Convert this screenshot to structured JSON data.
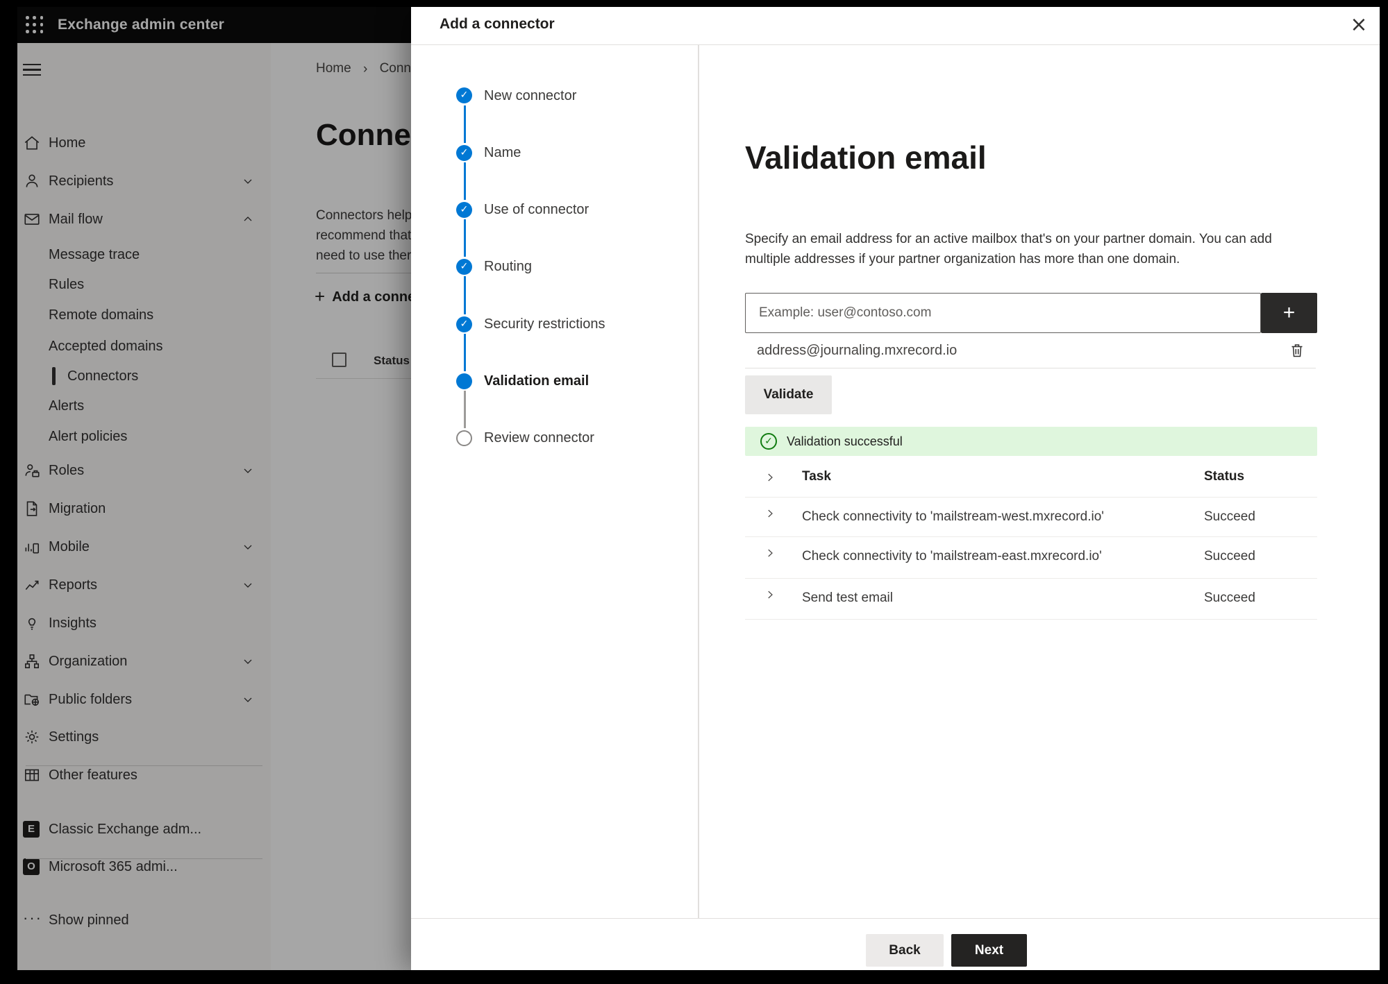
{
  "app_bar": {
    "title": "Exchange admin center"
  },
  "sidebar": {
    "items": [
      {
        "label": "Home"
      },
      {
        "label": "Recipients"
      },
      {
        "label": "Mail flow"
      },
      {
        "label": "Message trace"
      },
      {
        "label": "Rules"
      },
      {
        "label": "Remote domains"
      },
      {
        "label": "Accepted domains"
      },
      {
        "label": "Connectors",
        "selected": true
      },
      {
        "label": "Alerts"
      },
      {
        "label": "Alert policies"
      },
      {
        "label": "Roles"
      },
      {
        "label": "Migration"
      },
      {
        "label": "Mobile"
      },
      {
        "label": "Reports"
      },
      {
        "label": "Insights"
      },
      {
        "label": "Organization"
      },
      {
        "label": "Public folders"
      },
      {
        "label": "Settings"
      },
      {
        "label": "Other features"
      },
      {
        "label": "Classic Exchange adm..."
      },
      {
        "label": "Microsoft 365 admi..."
      },
      {
        "label": "Show pinned"
      }
    ]
  },
  "background_page": {
    "breadcrumb": {
      "home": "Home",
      "current": "Connectors"
    },
    "heading": "Connectors",
    "paragraph_lines": [
      "Connectors help",
      "recommend that",
      "need to use ther"
    ],
    "add_button": "Add a connector",
    "column_header": "Status"
  },
  "modal": {
    "title": "Add a connector",
    "close_label": "×",
    "steps": [
      {
        "label": "New connector",
        "state": "done"
      },
      {
        "label": "Name",
        "state": "done"
      },
      {
        "label": "Use of connector",
        "state": "done"
      },
      {
        "label": "Routing",
        "state": "done"
      },
      {
        "label": "Security restrictions",
        "state": "done"
      },
      {
        "label": "Validation email",
        "state": "current"
      },
      {
        "label": "Review connector",
        "state": "upcoming"
      }
    ],
    "content": {
      "title": "Validation email",
      "description": "Specify an email address for an active mailbox that's on your partner domain. You can add multiple addresses if your partner organization has more than one domain.",
      "input_placeholder": "Example: user@contoso.com",
      "add_address_label": "+",
      "added_address": "address@journaling.mxrecord.io",
      "validate_button": "Validate",
      "banner_text": "Validation successful",
      "banner_check": "✓",
      "table": {
        "task_header": "Task",
        "status_header": "Status",
        "rows": [
          {
            "task": "Check connectivity to 'mailstream-west.mxrecord.io'",
            "status": "Succeed"
          },
          {
            "task": "Check connectivity to 'mailstream-east.mxrecord.io'",
            "status": "Succeed"
          },
          {
            "task": "Send test email",
            "status": "Succeed"
          }
        ]
      }
    },
    "footer": {
      "back": "Back",
      "next": "Next"
    }
  },
  "colors": {
    "accent_blue": "#0078d4",
    "success_bg": "#dff6dd",
    "success_green": "#107c10",
    "dark_button": "#242322"
  }
}
